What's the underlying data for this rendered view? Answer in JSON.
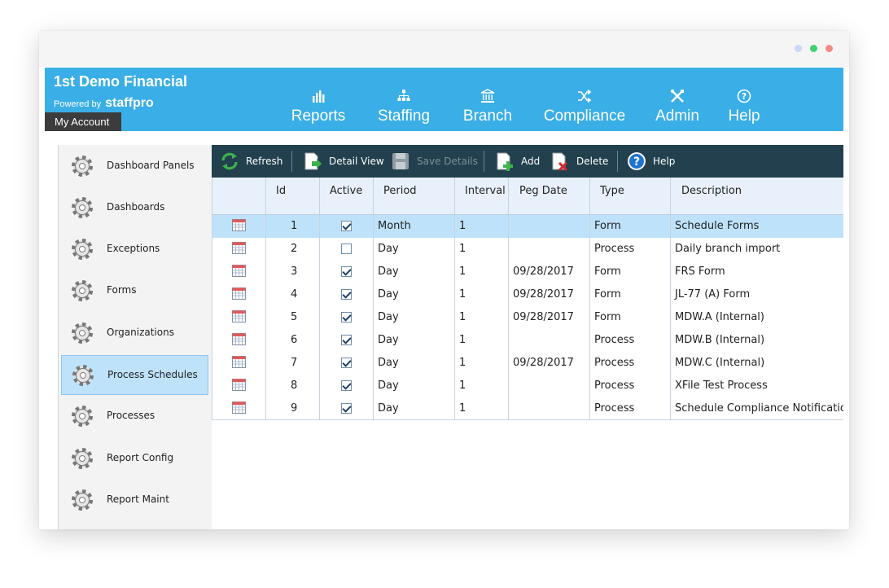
{
  "header": {
    "brand_title": "1st Demo Financial",
    "powered_by": "Powered by",
    "powered_logo": "staffpro",
    "my_account": "My Account"
  },
  "nav": {
    "items": [
      {
        "label": "Reports",
        "icon": "bar-chart-icon"
      },
      {
        "label": "Staffing",
        "icon": "org-chart-icon"
      },
      {
        "label": "Branch",
        "icon": "bank-icon"
      },
      {
        "label": "Compliance",
        "icon": "shuffle-icon"
      },
      {
        "label": "Admin",
        "icon": "tools-icon"
      },
      {
        "label": "Help",
        "icon": "help-circle-icon"
      }
    ]
  },
  "sidebar": {
    "items": [
      {
        "label": "Dashboard Panels"
      },
      {
        "label": "Dashboards"
      },
      {
        "label": "Exceptions"
      },
      {
        "label": "Forms"
      },
      {
        "label": "Organizations"
      },
      {
        "label": "Process Schedules",
        "active": true
      },
      {
        "label": "Processes"
      },
      {
        "label": "Report Config"
      },
      {
        "label": "Report Maint"
      }
    ]
  },
  "toolbar": {
    "refresh": "Refresh",
    "detail_view": "Detail View",
    "save_details": "Save Details",
    "add": "Add",
    "delete": "Delete",
    "help": "Help"
  },
  "grid": {
    "columns": [
      "Id",
      "Active",
      "Period",
      "Interval",
      "Peg Date",
      "Type",
      "Description"
    ],
    "rows": [
      {
        "id": "1",
        "active": true,
        "period": "Month",
        "interval": "1",
        "peg_date": "",
        "type": "Form",
        "description": "Schedule Forms",
        "selected": true
      },
      {
        "id": "2",
        "active": false,
        "period": "Day",
        "interval": "1",
        "peg_date": "",
        "type": "Process",
        "description": "Daily branch import"
      },
      {
        "id": "3",
        "active": true,
        "period": "Day",
        "interval": "1",
        "peg_date": "09/28/2017",
        "type": "Form",
        "description": "FRS Form"
      },
      {
        "id": "4",
        "active": true,
        "period": "Day",
        "interval": "1",
        "peg_date": "09/28/2017",
        "type": "Form",
        "description": "JL-77 (A) Form"
      },
      {
        "id": "5",
        "active": true,
        "period": "Day",
        "interval": "1",
        "peg_date": "09/28/2017",
        "type": "Form",
        "description": "MDW.A (Internal)"
      },
      {
        "id": "6",
        "active": true,
        "period": "Day",
        "interval": "1",
        "peg_date": "",
        "type": "Process",
        "description": "MDW.B (Internal)"
      },
      {
        "id": "7",
        "active": true,
        "period": "Day",
        "interval": "1",
        "peg_date": "09/28/2017",
        "type": "Process",
        "description": "MDW.C (Internal)"
      },
      {
        "id": "8",
        "active": true,
        "period": "Day",
        "interval": "1",
        "peg_date": "",
        "type": "Process",
        "description": "XFile Test Process"
      },
      {
        "id": "9",
        "active": true,
        "period": "Day",
        "interval": "1",
        "peg_date": "",
        "type": "Process",
        "description": "Schedule Compliance Notifications"
      }
    ]
  },
  "colors": {
    "header_blue": "#3aaee6",
    "toolbar_dark": "#22404d",
    "selection": "#bfe2fb"
  }
}
